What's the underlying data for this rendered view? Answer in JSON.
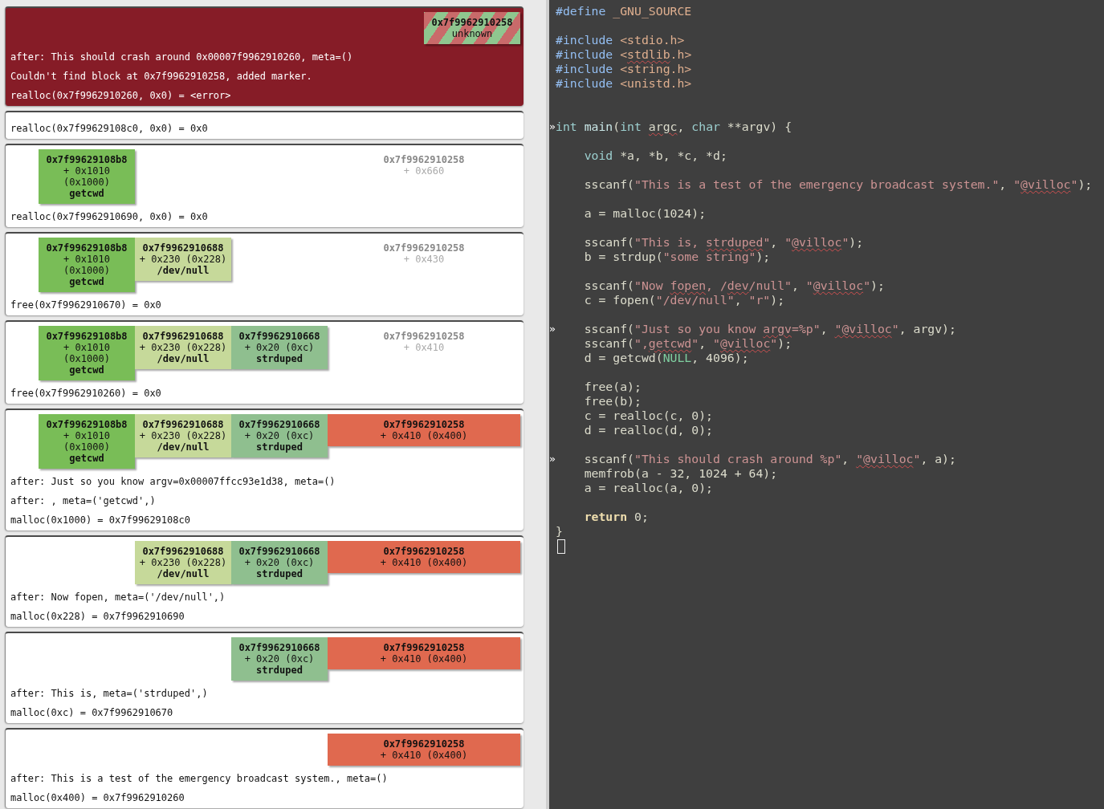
{
  "log_panels": [
    {
      "error": true,
      "blocks": [
        {
          "kind": "marker",
          "address": "0x7f9962910258",
          "lines": [
            "unknown"
          ]
        }
      ],
      "lines": [
        "after: This should crash around 0x00007f9962910260, meta=()",
        "Couldn't find block at 0x7f9962910258, added marker.",
        "realloc(0x7f9962910260, 0x0) = <error>"
      ]
    },
    {
      "error": false,
      "lines": [
        "realloc(0x7f99629108c0, 0x0) = 0x0"
      ]
    },
    {
      "error": false,
      "blocks": [
        {
          "kind": "chunk",
          "address": "0x7f99629108b8",
          "lines": [
            "+ 0x1010",
            "(0x1000)"
          ],
          "label": "getcwd",
          "color": "#79bd57"
        },
        {
          "kind": "free",
          "address": "0x7f9962910258",
          "lines": [
            "+ 0x660"
          ]
        }
      ],
      "lines": [
        "realloc(0x7f9962910690, 0x0) = 0x0"
      ]
    },
    {
      "error": false,
      "blocks": [
        {
          "kind": "chunk",
          "address": "0x7f99629108b8",
          "lines": [
            "+ 0x1010",
            "(0x1000)"
          ],
          "label": "getcwd",
          "color": "#79bd57"
        },
        {
          "kind": "chunk",
          "address": "0x7f9962910688",
          "lines": [
            "+ 0x230 (0x228)"
          ],
          "label": "/dev/null",
          "color": "#c6d99a"
        },
        {
          "kind": "free",
          "address": "0x7f9962910258",
          "lines": [
            "+ 0x430"
          ]
        }
      ],
      "lines": [
        "free(0x7f9962910670) = 0x0"
      ]
    },
    {
      "error": false,
      "blocks": [
        {
          "kind": "chunk",
          "address": "0x7f99629108b8",
          "lines": [
            "+ 0x1010",
            "(0x1000)"
          ],
          "label": "getcwd",
          "color": "#79bd57"
        },
        {
          "kind": "chunk",
          "address": "0x7f9962910688",
          "lines": [
            "+ 0x230 (0x228)"
          ],
          "label": "/dev/null",
          "color": "#c6d99a"
        },
        {
          "kind": "chunk",
          "address": "0x7f9962910668",
          "lines": [
            "+ 0x20 (0xc)"
          ],
          "label": "strduped",
          "color": "#8fbf8f"
        },
        {
          "kind": "free",
          "address": "0x7f9962910258",
          "lines": [
            "+ 0x410"
          ]
        }
      ],
      "lines": [
        "free(0x7f9962910260) = 0x0"
      ]
    },
    {
      "error": false,
      "blocks": [
        {
          "kind": "chunk",
          "address": "0x7f99629108b8",
          "lines": [
            "+ 0x1010",
            "(0x1000)"
          ],
          "label": "getcwd",
          "color": "#79bd57"
        },
        {
          "kind": "chunk",
          "address": "0x7f9962910688",
          "lines": [
            "+ 0x230 (0x228)"
          ],
          "label": "/dev/null",
          "color": "#c6d99a"
        },
        {
          "kind": "chunk",
          "address": "0x7f9962910668",
          "lines": [
            "+ 0x20 (0xc)"
          ],
          "label": "strduped",
          "color": "#8fbf8f"
        },
        {
          "kind": "chunk",
          "address": "0x7f9962910258",
          "lines": [
            "+ 0x410 (0x400)"
          ],
          "color": "#e0694f"
        }
      ],
      "lines": [
        "after: Just so you know argv=0x00007ffcc93e1d38, meta=()",
        "after: , meta=('getcwd',)",
        "malloc(0x1000) = 0x7f99629108c0"
      ]
    },
    {
      "error": false,
      "blocks": [
        {
          "kind": "chunk",
          "address": "0x7f9962910688",
          "lines": [
            "+ 0x230 (0x228)"
          ],
          "label": "/dev/null",
          "color": "#c6d99a"
        },
        {
          "kind": "chunk",
          "address": "0x7f9962910668",
          "lines": [
            "+ 0x20 (0xc)"
          ],
          "label": "strduped",
          "color": "#8fbf8f"
        },
        {
          "kind": "chunk",
          "address": "0x7f9962910258",
          "lines": [
            "+ 0x410 (0x400)"
          ],
          "color": "#e0694f"
        }
      ],
      "lines": [
        "after: Now fopen, meta=('/dev/null',)",
        "malloc(0x228) = 0x7f9962910690"
      ]
    },
    {
      "error": false,
      "blocks": [
        {
          "kind": "chunk",
          "address": "0x7f9962910668",
          "lines": [
            "+ 0x20 (0xc)"
          ],
          "label": "strduped",
          "color": "#8fbf8f"
        },
        {
          "kind": "chunk",
          "address": "0x7f9962910258",
          "lines": [
            "+ 0x410 (0x400)"
          ],
          "color": "#e0694f"
        }
      ],
      "lines": [
        "after: This is, meta=('strduped',)",
        "malloc(0xc) = 0x7f9962910670"
      ]
    },
    {
      "error": false,
      "blocks": [
        {
          "kind": "chunk",
          "address": "0x7f9962910258",
          "lines": [
            "+ 0x410 (0x400)"
          ],
          "color": "#e0694f"
        }
      ],
      "lines": [
        "after: This is a test of the emergency broadcast system., meta=()",
        "malloc(0x400) = 0x7f9962910260"
      ]
    }
  ],
  "editor": {
    "lines": [
      {
        "tokens": [
          {
            "kind": "preproc",
            "text": "#define "
          },
          {
            "kind": "header",
            "text": "_GNU_SOURCE"
          }
        ]
      },
      {
        "blank": true
      },
      {
        "tokens": [
          {
            "kind": "preproc",
            "text": "#include "
          },
          {
            "kind": "header",
            "text": "<stdio.h>"
          }
        ]
      },
      {
        "tokens": [
          {
            "kind": "preproc",
            "text": "#include "
          },
          {
            "kind": "header",
            "text": "<"
          },
          {
            "kind": "header",
            "text": "stdlib",
            "misspelled": true
          },
          {
            "kind": "header",
            "text": ".h>"
          }
        ]
      },
      {
        "tokens": [
          {
            "kind": "preproc",
            "text": "#include "
          },
          {
            "kind": "header",
            "text": "<string.h>"
          }
        ]
      },
      {
        "tokens": [
          {
            "kind": "preproc",
            "text": "#include "
          },
          {
            "kind": "header",
            "text": "<unistd.h>"
          }
        ]
      },
      {
        "blank": true
      },
      {
        "blank": true
      },
      {
        "gutter": "»",
        "tokens": [
          {
            "kind": "type",
            "text": "int "
          },
          {
            "kind": "func",
            "text": "main"
          },
          {
            "kind": "plain",
            "text": "("
          },
          {
            "kind": "type",
            "text": "int "
          },
          {
            "kind": "plain",
            "text": "argc",
            "misspelled": true
          },
          {
            "kind": "plain",
            "text": ", "
          },
          {
            "kind": "type",
            "text": "char"
          },
          {
            "kind": "plain",
            "text": " **argv) {"
          }
        ]
      },
      {
        "blank": true
      },
      {
        "tokens": [
          {
            "kind": "type",
            "text": "    void"
          },
          {
            "kind": "plain",
            "text": " *a, *b, *c, *d;"
          }
        ]
      },
      {
        "blank": true
      },
      {
        "tokens": [
          {
            "kind": "plain",
            "text": "    sscanf("
          },
          {
            "kind": "string",
            "text": "\"This is a test of the emergency broadcast system.\""
          },
          {
            "kind": "plain",
            "text": ", "
          },
          {
            "kind": "string",
            "text": "\""
          },
          {
            "kind": "string",
            "text": "@villoc",
            "misspelled": true
          },
          {
            "kind": "string",
            "text": "\""
          },
          {
            "kind": "plain",
            "text": ");"
          }
        ]
      },
      {
        "blank": true
      },
      {
        "tokens": [
          {
            "kind": "plain",
            "text": "    a = malloc(1024);"
          }
        ]
      },
      {
        "blank": true
      },
      {
        "tokens": [
          {
            "kind": "plain",
            "text": "    sscanf("
          },
          {
            "kind": "string",
            "text": "\"This is, "
          },
          {
            "kind": "string",
            "text": "strduped",
            "misspelled": true
          },
          {
            "kind": "string",
            "text": "\""
          },
          {
            "kind": "plain",
            "text": ", "
          },
          {
            "kind": "string",
            "text": "\""
          },
          {
            "kind": "string",
            "text": "@villoc",
            "misspelled": true
          },
          {
            "kind": "string",
            "text": "\""
          },
          {
            "kind": "plain",
            "text": ");"
          }
        ]
      },
      {
        "tokens": [
          {
            "kind": "plain",
            "text": "    b = strdup("
          },
          {
            "kind": "string",
            "text": "\"some string\""
          },
          {
            "kind": "plain",
            "text": ");"
          }
        ]
      },
      {
        "blank": true
      },
      {
        "tokens": [
          {
            "kind": "plain",
            "text": "    sscanf("
          },
          {
            "kind": "string",
            "text": "\"Now "
          },
          {
            "kind": "string",
            "text": "fopen",
            "misspelled": true
          },
          {
            "kind": "string",
            "text": ", /"
          },
          {
            "kind": "string",
            "text": "dev",
            "misspelled": true
          },
          {
            "kind": "string",
            "text": "/null\""
          },
          {
            "kind": "plain",
            "text": ", "
          },
          {
            "kind": "string",
            "text": "\""
          },
          {
            "kind": "string",
            "text": "@villoc",
            "misspelled": true
          },
          {
            "kind": "string",
            "text": "\""
          },
          {
            "kind": "plain",
            "text": ");"
          }
        ]
      },
      {
        "tokens": [
          {
            "kind": "plain",
            "text": "    c = fopen("
          },
          {
            "kind": "string",
            "text": "\"/dev/null\""
          },
          {
            "kind": "plain",
            "text": ", "
          },
          {
            "kind": "string",
            "text": "\"r\""
          },
          {
            "kind": "plain",
            "text": ");"
          }
        ]
      },
      {
        "blank": true
      },
      {
        "gutter": "»",
        "tokens": [
          {
            "kind": "plain",
            "text": "    sscanf("
          },
          {
            "kind": "string",
            "text": "\"Just so you know "
          },
          {
            "kind": "string",
            "text": "argv",
            "misspelled": true
          },
          {
            "kind": "string",
            "text": "=%p\""
          },
          {
            "kind": "plain",
            "text": ", "
          },
          {
            "kind": "string",
            "text": "\"@villoc",
            "misspelled": true
          },
          {
            "kind": "string",
            "text": "\""
          },
          {
            "kind": "plain",
            "text": ", argv);"
          }
        ]
      },
      {
        "tokens": [
          {
            "kind": "plain",
            "text": "    sscanf("
          },
          {
            "kind": "string",
            "text": "\","
          },
          {
            "kind": "string",
            "text": "getcwd",
            "misspelled": true
          },
          {
            "kind": "string",
            "text": "\""
          },
          {
            "kind": "plain",
            "text": ", "
          },
          {
            "kind": "string",
            "text": "\""
          },
          {
            "kind": "string",
            "text": "@villoc",
            "misspelled": true
          },
          {
            "kind": "string",
            "text": "\""
          },
          {
            "kind": "plain",
            "text": ");"
          }
        ]
      },
      {
        "tokens": [
          {
            "kind": "plain",
            "text": "    d = getcwd("
          },
          {
            "kind": "constant",
            "text": "NULL"
          },
          {
            "kind": "plain",
            "text": ", 4096);"
          }
        ]
      },
      {
        "blank": true
      },
      {
        "tokens": [
          {
            "kind": "plain",
            "text": "    free(a);"
          }
        ]
      },
      {
        "tokens": [
          {
            "kind": "plain",
            "text": "    free(b);"
          }
        ]
      },
      {
        "tokens": [
          {
            "kind": "plain",
            "text": "    c = realloc(c, 0);"
          }
        ]
      },
      {
        "tokens": [
          {
            "kind": "plain",
            "text": "    d = realloc(d, 0);"
          }
        ]
      },
      {
        "blank": true
      },
      {
        "gutter": "»",
        "tokens": [
          {
            "kind": "plain",
            "text": "    sscanf("
          },
          {
            "kind": "string",
            "text": "\"This should crash around %p\""
          },
          {
            "kind": "plain",
            "text": ", "
          },
          {
            "kind": "string",
            "text": "\"@villoc",
            "misspelled": true
          },
          {
            "kind": "string",
            "text": "\""
          },
          {
            "kind": "plain",
            "text": ", a);"
          }
        ]
      },
      {
        "tokens": [
          {
            "kind": "plain",
            "text": "    memfrob(a - 32, 1024 + 64);"
          }
        ]
      },
      {
        "tokens": [
          {
            "kind": "plain",
            "text": "    a = realloc(a, 0);"
          }
        ]
      },
      {
        "blank": true
      },
      {
        "tokens": [
          {
            "kind": "keyword",
            "text": "    return"
          },
          {
            "kind": "plain",
            "text": " 0;"
          }
        ]
      },
      {
        "tokens": [
          {
            "kind": "plain",
            "text": "}"
          }
        ]
      }
    ]
  }
}
